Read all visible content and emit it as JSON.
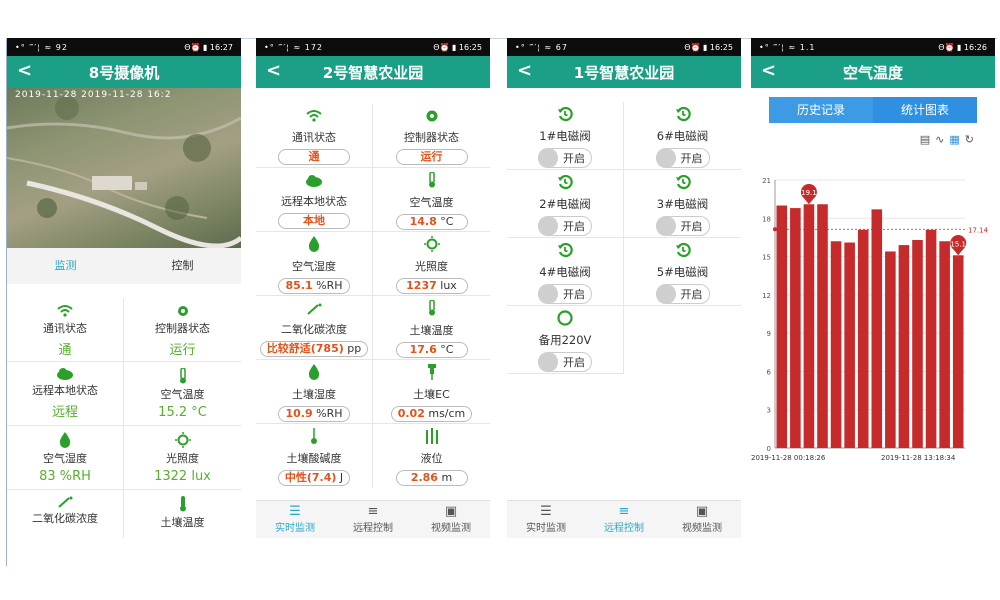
{
  "statusbars": [
    {
      "left": "•° ‴′¦ ≈ 92",
      "right": "Θ⏰ ▮ 16:27"
    },
    {
      "left": "•° ‴′¦ ≈ 172",
      "right": "Θ⏰ ▮ 16:25"
    },
    {
      "left": "•° ‴′¦ ≈ 67",
      "right": "Θ⏰ ▮ 16:25"
    },
    {
      "left": "•° ‴′¦ ≈ 1.1",
      "right": "Θ⏰ ▮ 16:26"
    }
  ],
  "screen1": {
    "title": "8号摄像机",
    "cam_timestamp": "2019-11-28 2019-11-28 16:2",
    "tabs": [
      "监测",
      "控制"
    ],
    "cells": [
      {
        "label": "通讯状态",
        "value": "通",
        "icon": "wifi-icon"
      },
      {
        "label": "控制器状态",
        "value": "运行",
        "icon": "gear-icon"
      },
      {
        "label": "远程本地状态",
        "value": "远程",
        "icon": "cloud-icon"
      },
      {
        "label": "空气温度",
        "value": "15.2 °C",
        "icon": "thermometer-icon"
      },
      {
        "label": "空气湿度",
        "value": "83 %RH",
        "icon": "humidity-icon"
      },
      {
        "label": "光照度",
        "value": "1322 lux",
        "icon": "sun-icon"
      },
      {
        "label": "二氧化碳浓度",
        "value": "",
        "icon": "co2-icon"
      },
      {
        "label": "土壤温度",
        "value": "",
        "icon": "thermometer-icon"
      }
    ]
  },
  "screen2": {
    "title": "2号智慧农业园",
    "cells": [
      {
        "label": "通讯状态",
        "value": "通",
        "unit": "",
        "icon": "wifi-icon"
      },
      {
        "label": "控制器状态",
        "value": "运行",
        "unit": "",
        "icon": "gear-icon"
      },
      {
        "label": "远程本地状态",
        "value": "本地",
        "unit": "",
        "icon": "cloud-icon"
      },
      {
        "label": "空气温度",
        "value": "14.8",
        "unit": "°C",
        "icon": "thermometer-icon"
      },
      {
        "label": "空气湿度",
        "value": "85.1",
        "unit": "%RH",
        "icon": "humidity-icon"
      },
      {
        "label": "光照度",
        "value": "1237",
        "unit": "lux",
        "icon": "sun-icon"
      },
      {
        "label": "二氧化碳浓度",
        "value": "比较舒适(785)",
        "unit": "pp",
        "icon": "co2-icon"
      },
      {
        "label": "土壤温度",
        "value": "17.6",
        "unit": "°C",
        "icon": "thermometer-icon"
      },
      {
        "label": "土壤湿度",
        "value": "10.9",
        "unit": "%RH",
        "icon": "humidity-icon"
      },
      {
        "label": "土壤EC",
        "value": "0.02",
        "unit": "ms/cm",
        "icon": "pin-icon"
      },
      {
        "label": "土壤酸碱度",
        "value": "中性(7.4)",
        "unit": "J",
        "icon": "ph-icon"
      },
      {
        "label": "液位",
        "value": "2.86",
        "unit": "m",
        "icon": "level-icon"
      }
    ],
    "nav": [
      {
        "label": "实时监测",
        "icon": "list-icon",
        "active": true
      },
      {
        "label": "远程控制",
        "icon": "bullet-list-icon",
        "active": false
      },
      {
        "label": "视频监测",
        "icon": "video-icon",
        "active": false
      }
    ]
  },
  "screen3": {
    "title": "1号智慧农业园",
    "valves": [
      {
        "label": "1#电磁阀",
        "state": "开启"
      },
      {
        "label": "6#电磁阀",
        "state": "开启"
      },
      {
        "label": "2#电磁阀",
        "state": "开启"
      },
      {
        "label": "3#电磁阀",
        "state": "开启"
      },
      {
        "label": "4#电磁阀",
        "state": "开启"
      },
      {
        "label": "5#电磁阀",
        "state": "开启"
      },
      {
        "label": "备用220V",
        "state": "开启"
      }
    ],
    "nav": [
      {
        "label": "实时监测",
        "icon": "list-icon",
        "active": false
      },
      {
        "label": "远程控制",
        "icon": "bullet-list-icon",
        "active": true
      },
      {
        "label": "视频监测",
        "icon": "video-icon",
        "active": false
      }
    ]
  },
  "screen4": {
    "title": "空气温度",
    "seg": [
      "历史记录",
      "统计图表"
    ],
    "tool_icons": [
      "document-icon",
      "line-chart-icon",
      "bar-chart-icon",
      "refresh-icon"
    ]
  },
  "chart_data": {
    "type": "bar",
    "x_labels": [
      "2019-11-28 00:18:26",
      "2019-11-28 13:18:34"
    ],
    "values": [
      19.0,
      18.8,
      19.1,
      19.1,
      16.2,
      16.1,
      17.1,
      18.7,
      15.4,
      15.9,
      16.3,
      17.1,
      16.2,
      15.1
    ],
    "ylim": [
      0,
      21
    ],
    "yticks": [
      0,
      3,
      6,
      9,
      12,
      15,
      18,
      21
    ],
    "avg": 17.14,
    "avg_label": "17.14",
    "max_marker": "19.1",
    "min_marker": "15.1",
    "bar_color": "#c62b2b"
  },
  "colors": {
    "accent": "#1ba087",
    "green": "#2aa02a",
    "orange": "#e0531b",
    "segBlue": "#2f8fe0"
  }
}
